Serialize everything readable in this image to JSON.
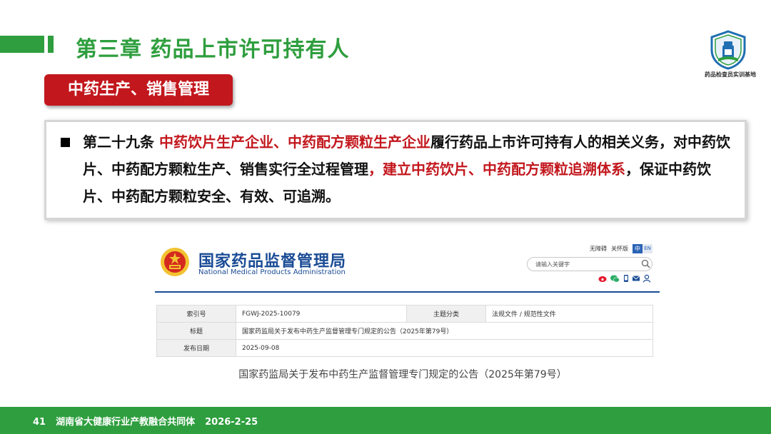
{
  "header": {
    "chapter_title": "第三章  药品上市许可持有人",
    "badge_text": "药品检查员实训基地"
  },
  "section_label": "中药生产、销售管理",
  "article": {
    "seg1": "第二十九条  ",
    "seg2_red": "中药饮片生产企业、中药配方颗粒生产企业",
    "seg3": "履行药品上市许可持有人的相关义务，对中药饮片、中药配方颗粒生产、销售实行全过程管理",
    "seg4_red": "，建立中药饮片、中药配方颗粒追溯体系",
    "seg5": "，保证中药饮片、中药配方颗粒安全、有效、可追溯。"
  },
  "nmpa": {
    "name_cn": "国家药品监督管理局",
    "name_en": "National Medical Products Administration",
    "link_accessible": "无障碍",
    "link_care": "关怀版",
    "lang_cn": "中",
    "lang_en": "EN",
    "search_placeholder": "请输入关键字",
    "social_icons": [
      "weibo-icon",
      "wechat-icon",
      "mobile-icon",
      "email-icon",
      "user-icon"
    ]
  },
  "info_table": {
    "index_label": "索引号",
    "index_value": "FGWJ-2025-10079",
    "category_label": "主题分类",
    "category_value": "法规文件 / 规范性文件",
    "title_label": "标题",
    "title_value": "国家药监局关于发布中药生产监督管理专门规定的公告（2025年第79号）",
    "date_label": "发布日期",
    "date_value": "2025-09-08"
  },
  "caption": "国家药监局关于发布中药生产监督管理专门规定的公告（2025年第79号）",
  "footer": {
    "page_number": "41",
    "org": "湖南省大健康行业产教融合共同体",
    "date": "2026-2-25"
  },
  "colors": {
    "brand_green": "#2e9e3e",
    "accent_red": "#c2171d",
    "nmpa_blue": "#1a4b95"
  }
}
